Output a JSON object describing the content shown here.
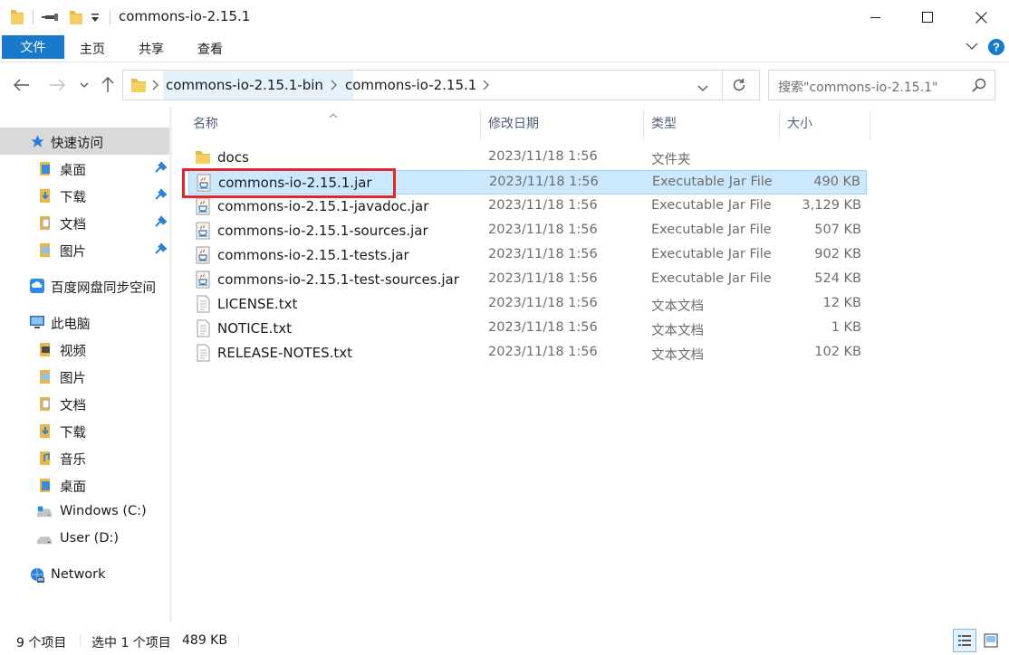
{
  "window": {
    "title": "commons-io-2.15.1"
  },
  "ribbon": {
    "tabs": [
      {
        "label": "文件"
      },
      {
        "label": "主页"
      },
      {
        "label": "共享"
      },
      {
        "label": "查看"
      }
    ]
  },
  "address": {
    "crumbs": [
      "commons-io-2.15.1-bin",
      "commons-io-2.15.1"
    ]
  },
  "search": {
    "placeholder": "搜索\"commons-io-2.15.1\""
  },
  "nav": {
    "quick_access": "快速访问",
    "quick_items": [
      "桌面",
      "下载",
      "文档",
      "图片"
    ],
    "baidu": "百度网盘同步空间",
    "this_pc": "此电脑",
    "pc_items": [
      "视频",
      "图片",
      "文档",
      "下载",
      "音乐",
      "桌面"
    ],
    "drives": [
      "Windows (C:)",
      "User (D:)"
    ],
    "network": "Network"
  },
  "list": {
    "columns": {
      "name": "名称",
      "date": "修改日期",
      "type": "类型",
      "size": "大小"
    },
    "files": [
      {
        "name": "docs",
        "date": "2023/11/18 1:56",
        "type": "文件夹",
        "size": "",
        "icon": "folder-icon"
      },
      {
        "name": "commons-io-2.15.1.jar",
        "date": "2023/11/18 1:56",
        "type": "Executable Jar File",
        "size": "490 KB",
        "icon": "jar-icon",
        "selected": true
      },
      {
        "name": "commons-io-2.15.1-javadoc.jar",
        "date": "2023/11/18 1:56",
        "type": "Executable Jar File",
        "size": "3,129 KB",
        "icon": "jar-icon"
      },
      {
        "name": "commons-io-2.15.1-sources.jar",
        "date": "2023/11/18 1:56",
        "type": "Executable Jar File",
        "size": "507 KB",
        "icon": "jar-icon"
      },
      {
        "name": "commons-io-2.15.1-tests.jar",
        "date": "2023/11/18 1:56",
        "type": "Executable Jar File",
        "size": "902 KB",
        "icon": "jar-icon"
      },
      {
        "name": "commons-io-2.15.1-test-sources.jar",
        "date": "2023/11/18 1:56",
        "type": "Executable Jar File",
        "size": "524 KB",
        "icon": "jar-icon"
      },
      {
        "name": "LICENSE.txt",
        "date": "2023/11/18 1:56",
        "type": "文本文档",
        "size": "12 KB",
        "icon": "text-file-icon"
      },
      {
        "name": "NOTICE.txt",
        "date": "2023/11/18 1:56",
        "type": "文本文档",
        "size": "1 KB",
        "icon": "text-file-icon"
      },
      {
        "name": "RELEASE-NOTES.txt",
        "date": "2023/11/18 1:56",
        "type": "文本文档",
        "size": "102 KB",
        "icon": "text-file-icon"
      }
    ]
  },
  "status": {
    "count": "9 个项目",
    "selected": "选中 1 个项目",
    "size": "489 KB"
  },
  "colors": {
    "accent": "#1979ca",
    "selection": "#cce8ff",
    "highlight_box": "#e8242b"
  }
}
